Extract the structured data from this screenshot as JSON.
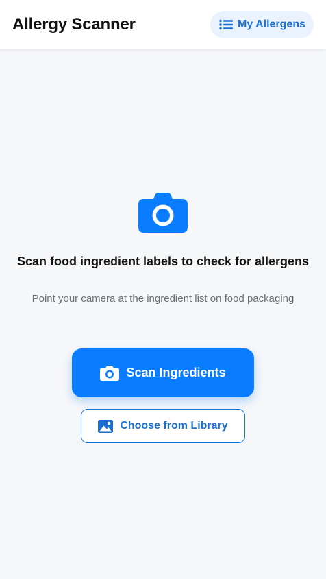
{
  "header": {
    "title": "Allergy Scanner",
    "allergens_button_label": "My Allergens",
    "allergens_button_icon": "list-icon"
  },
  "main": {
    "hero_icon": "camera-icon",
    "heading": "Scan food ingredient labels to check for allergens",
    "subtext": "Point your camera at the ingredient list on food packaging",
    "scan_button": {
      "label": "Scan Ingredients",
      "icon": "camera-icon"
    },
    "library_button": {
      "label": "Choose from Library",
      "icon": "image-icon"
    }
  },
  "colors": {
    "primary": "#0a7cff",
    "primary_text": "#1a6fd1",
    "chip_background": "#eaf3fd",
    "background": "#f6f7f9",
    "heading_text": "#151515",
    "muted_text": "#6b6f76"
  }
}
